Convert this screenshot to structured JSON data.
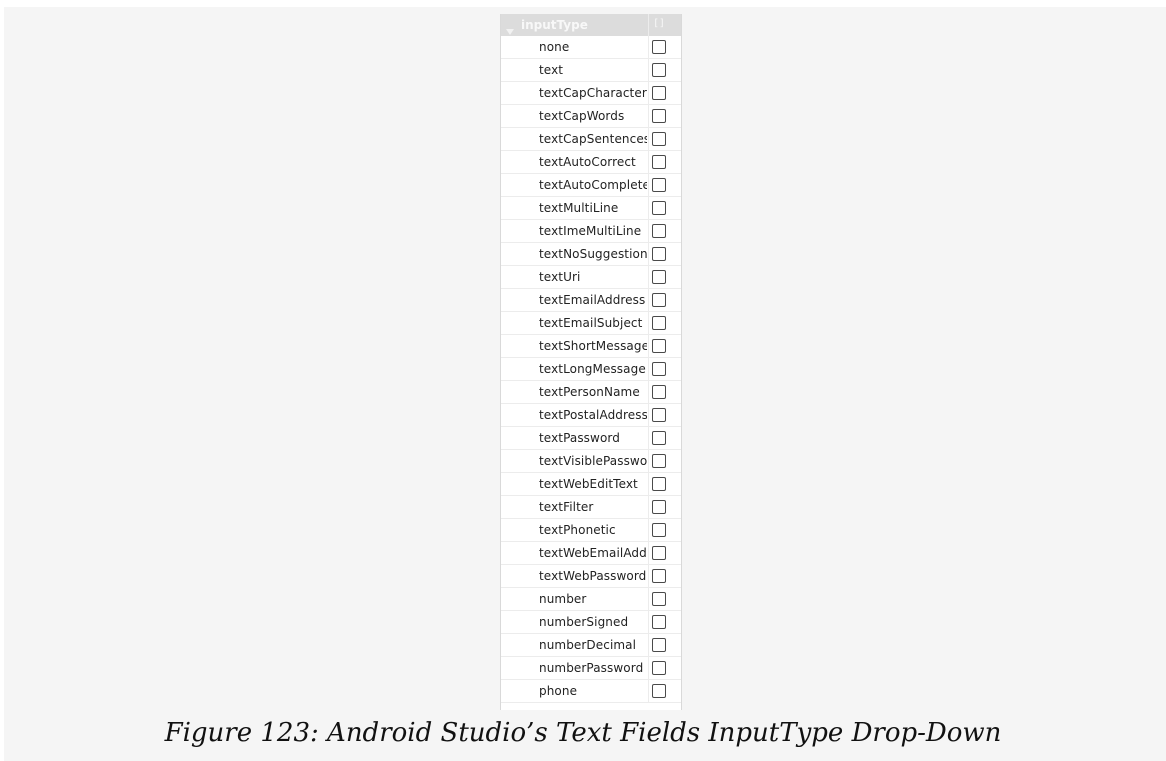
{
  "panel": {
    "header": {
      "title": "inputType",
      "value": "[]",
      "expand_icon": "triangle-down-icon"
    },
    "options": [
      {
        "label": "none",
        "checked": false
      },
      {
        "label": "text",
        "checked": false
      },
      {
        "label": "textCapCharacter",
        "checked": false
      },
      {
        "label": "textCapWords",
        "checked": false
      },
      {
        "label": "textCapSentences",
        "checked": false
      },
      {
        "label": "textAutoCorrect",
        "checked": false
      },
      {
        "label": "textAutoComplete",
        "checked": false
      },
      {
        "label": "textMultiLine",
        "checked": false
      },
      {
        "label": "textImeMultiLine",
        "checked": false
      },
      {
        "label": "textNoSuggestion",
        "checked": false
      },
      {
        "label": "textUri",
        "checked": false
      },
      {
        "label": "textEmailAddress",
        "checked": false
      },
      {
        "label": "textEmailSubject",
        "checked": false
      },
      {
        "label": "textShortMessage",
        "checked": false
      },
      {
        "label": "textLongMessage",
        "checked": false
      },
      {
        "label": "textPersonName",
        "checked": false
      },
      {
        "label": "textPostalAddress",
        "checked": false
      },
      {
        "label": "textPassword",
        "checked": false
      },
      {
        "label": "textVisiblePasswo",
        "checked": false
      },
      {
        "label": "textWebEditText",
        "checked": false
      },
      {
        "label": "textFilter",
        "checked": false
      },
      {
        "label": "textPhonetic",
        "checked": false
      },
      {
        "label": "textWebEmailAddr",
        "checked": false
      },
      {
        "label": "textWebPassword",
        "checked": false
      },
      {
        "label": "number",
        "checked": false
      },
      {
        "label": "numberSigned",
        "checked": false
      },
      {
        "label": "numberDecimal",
        "checked": false
      },
      {
        "label": "numberPassword",
        "checked": false
      },
      {
        "label": "phone",
        "checked": false
      }
    ]
  },
  "caption": "Figure 123: Android Studio’s Text Fields InputType Drop-Down"
}
